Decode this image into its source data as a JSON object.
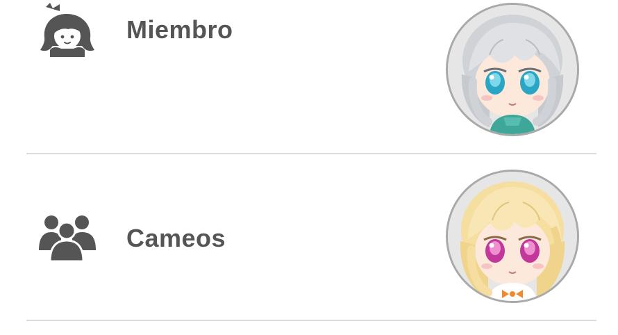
{
  "rows": [
    {
      "label": "Miembro",
      "icon": "member-girl-icon",
      "avatar": "character-avatar-silver-hair"
    },
    {
      "label": "Cameos",
      "icon": "group-people-icon",
      "avatar": "character-avatar-blonde-hair"
    }
  ],
  "colors": {
    "icon": "#555555",
    "label": "#555555",
    "divider": "#dcdcdc",
    "avatar_border": "#a9a9a9",
    "avatar_bg": "#e4e4e4"
  }
}
